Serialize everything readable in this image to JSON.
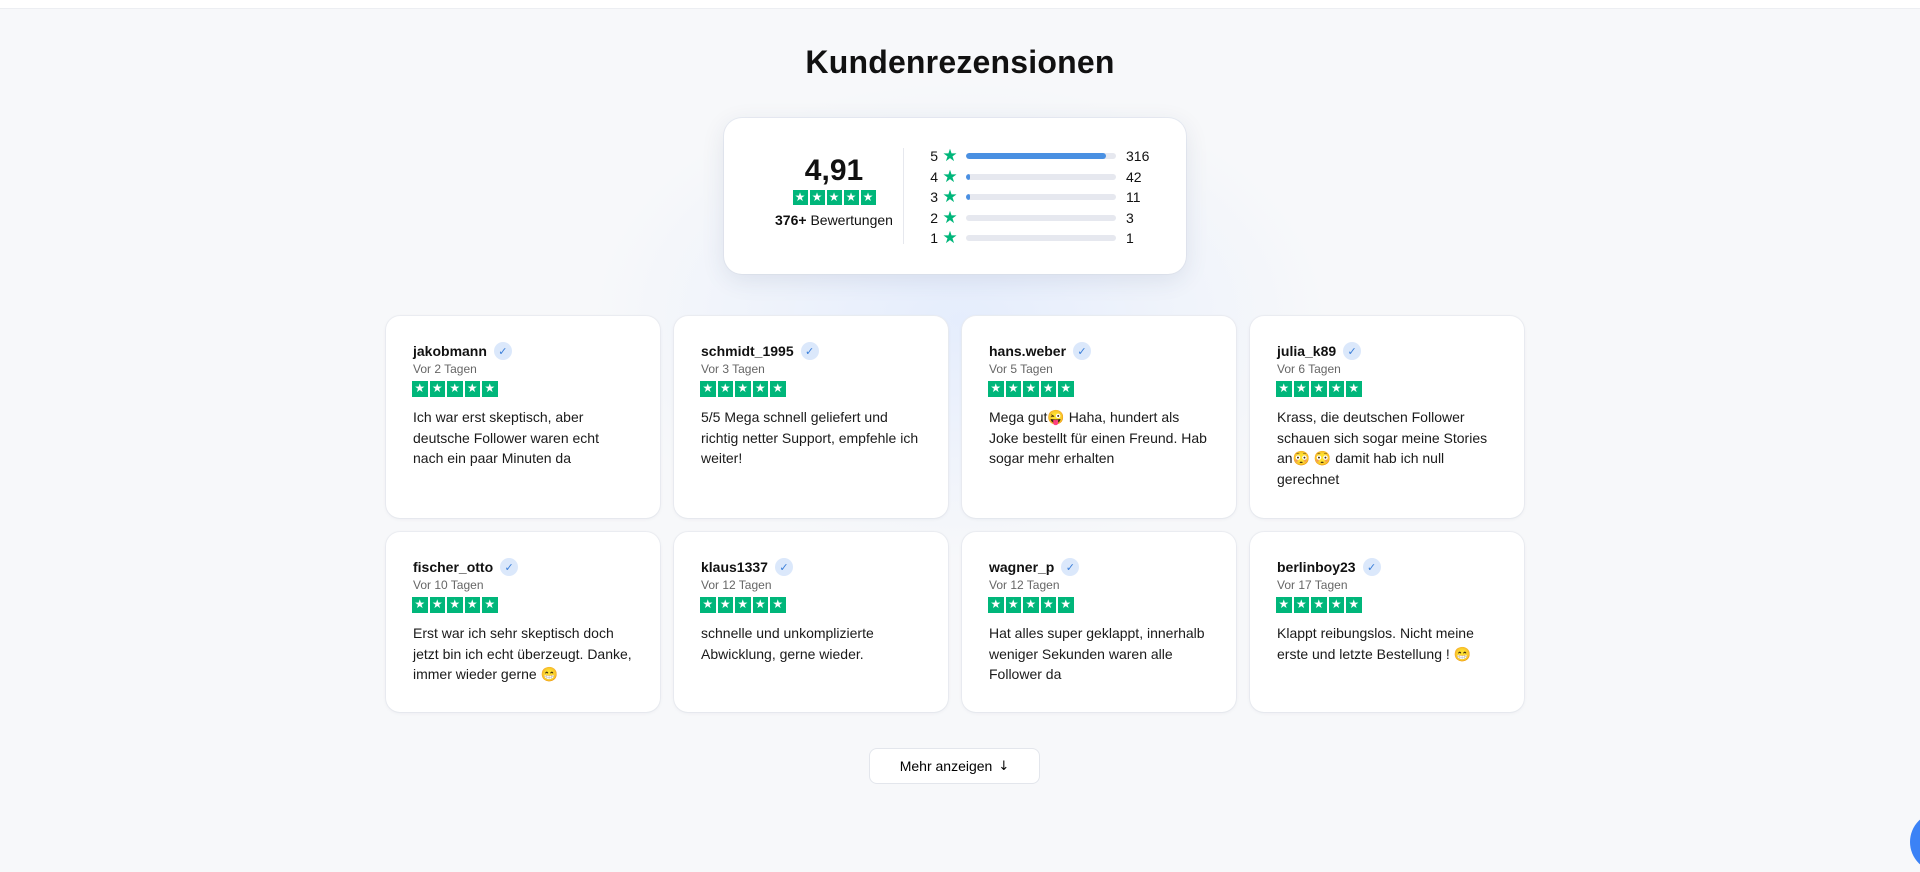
{
  "page": {
    "title": "Kundenrezensionen"
  },
  "summary": {
    "score": "4,91",
    "rating_count_bold": "376+",
    "rating_count_label": " Bewertungen",
    "star_color": "#00b67a",
    "bar_color": "#4a90e2",
    "distribution": [
      {
        "stars": "5",
        "count": "316",
        "fraction": 0.93
      },
      {
        "stars": "4",
        "count": "42",
        "fraction": 0.03
      },
      {
        "stars": "3",
        "count": "11",
        "fraction": 0.02
      },
      {
        "stars": "2",
        "count": "3",
        "fraction": 0
      },
      {
        "stars": "1",
        "count": "1",
        "fraction": 0
      }
    ]
  },
  "reviews": [
    {
      "user": "jakobmann",
      "date": "Vor 2 Tagen",
      "rating": 5,
      "text": "Ich war erst skeptisch, aber deutsche Follower waren echt nach ein paar Minuten da"
    },
    {
      "user": "schmidt_1995",
      "date": "Vor 3 Tagen",
      "rating": 5,
      "text": "5/5 Mega schnell geliefert und richtig netter Support, empfehle ich weiter!"
    },
    {
      "user": "hans.weber",
      "date": "Vor 5 Tagen",
      "rating": 5,
      "text": "Mega gut😜 Haha, hundert als Joke bestellt für einen Freund. Hab sogar mehr erhalten"
    },
    {
      "user": "julia_k89",
      "date": "Vor 6 Tagen",
      "rating": 5,
      "text": "Krass, die deutschen Follower schauen sich sogar meine Stories an😳 😳 damit hab ich null gerechnet"
    },
    {
      "user": "fischer_otto",
      "date": "Vor 10 Tagen",
      "rating": 5,
      "text": "Erst war ich sehr skeptisch doch jetzt bin ich echt überzeugt. Danke, immer wieder gerne 😁"
    },
    {
      "user": "klaus1337",
      "date": "Vor 12 Tagen",
      "rating": 5,
      "text": "schnelle und unkomplizierte Abwicklung, gerne wieder."
    },
    {
      "user": "wagner_p",
      "date": "Vor 12 Tagen",
      "rating": 5,
      "text": "Hat alles super geklappt, innerhalb weniger Sekunden waren alle Follower da"
    },
    {
      "user": "berlinboy23",
      "date": "Vor 17 Tagen",
      "rating": 5,
      "text": "Klappt reibungslos. Nicht meine erste und letzte Bestellung ! 😁"
    }
  ],
  "more_button": {
    "label": "Mehr anzeigen",
    "icon": "arrow-down-icon"
  },
  "chat_button": {
    "icon": "chat-icon",
    "color": "#3b82f6"
  }
}
